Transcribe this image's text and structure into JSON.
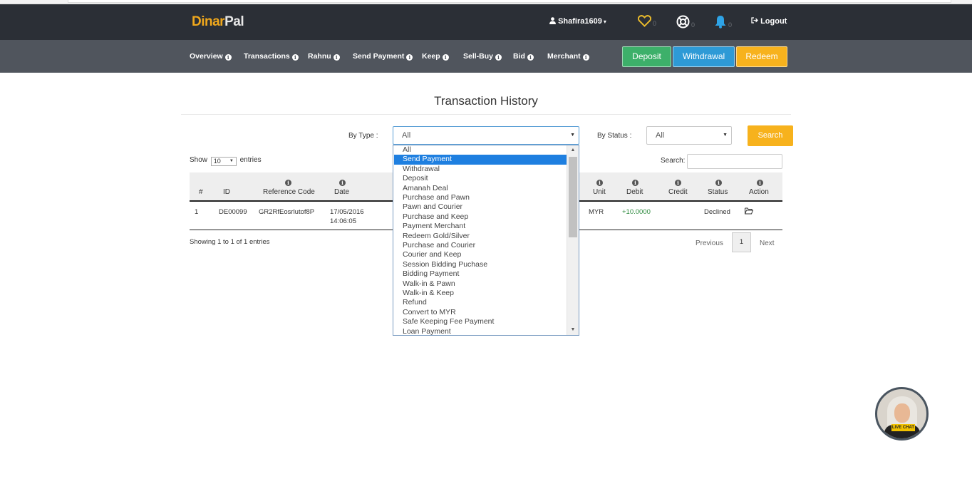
{
  "header": {
    "logo_part1": "Dinar",
    "logo_part2": "Pal",
    "username": "Shafira1609",
    "fav_count": "0",
    "support_count": "0",
    "notif_count": "0",
    "logout_label": "Logout"
  },
  "nav": {
    "items": [
      "Overview",
      "Transactions",
      "Rahnu",
      "Send Payment",
      "Keep",
      "Sell-Buy",
      "Bid",
      "Merchant"
    ],
    "deposit_label": "Deposit",
    "withdrawal_label": "Withdrawal",
    "redeem_label": "Redeem"
  },
  "page": {
    "title": "Transaction History"
  },
  "filters": {
    "type_label": "By Type :",
    "type_value": "All",
    "status_label": "By Status :",
    "status_value": "All",
    "search_button": "Search",
    "type_options": [
      "All",
      "Send Payment",
      "Withdrawal",
      "Deposit",
      "Amanah Deal",
      "Purchase and Pawn",
      "Pawn and Courier",
      "Purchase and Keep",
      "Payment Merchant",
      "Redeem Gold/Silver",
      "Purchase and Courier",
      "Courier and Keep",
      "Session Bidding Puchase",
      "Bidding Payment",
      "Walk-in & Pawn",
      "Walk-in & Keep",
      "Refund",
      "Convert to MYR",
      "Safe Keeping Fee Payment",
      "Loan Payment"
    ],
    "highlighted_option": "Send Payment"
  },
  "table_controls": {
    "show_label": "Show",
    "entries_value": "10",
    "entries_label": "entries",
    "search_label": "Search:",
    "search_value": ""
  },
  "table": {
    "columns": [
      "#",
      "ID",
      "Reference Code",
      "Date",
      "Unit",
      "Debit",
      "Credit",
      "Status",
      "Action"
    ],
    "rows": [
      {
        "num": "1",
        "id": "DE00099",
        "ref": "GR2RfEosrlutof8P",
        "date": "17/05/2016",
        "time": "14:06:05",
        "unit": "MYR",
        "debit": "+10.0000",
        "credit": "",
        "status": "Declined"
      }
    ]
  },
  "footer": {
    "showing": "Showing 1 to 1 of 1 entries",
    "previous": "Previous",
    "page": "1",
    "next": "Next"
  },
  "livechat": {
    "label": "LIVE CHAT"
  },
  "colors": {
    "topbar": "#2b2f36",
    "navbar": "#50555d",
    "deposit": "#3db06a",
    "withdrawal": "#2e9ad6",
    "redeem": "#f7b21d",
    "logo_accent": "#f0a81c",
    "selected_option": "#1e7fe0"
  }
}
